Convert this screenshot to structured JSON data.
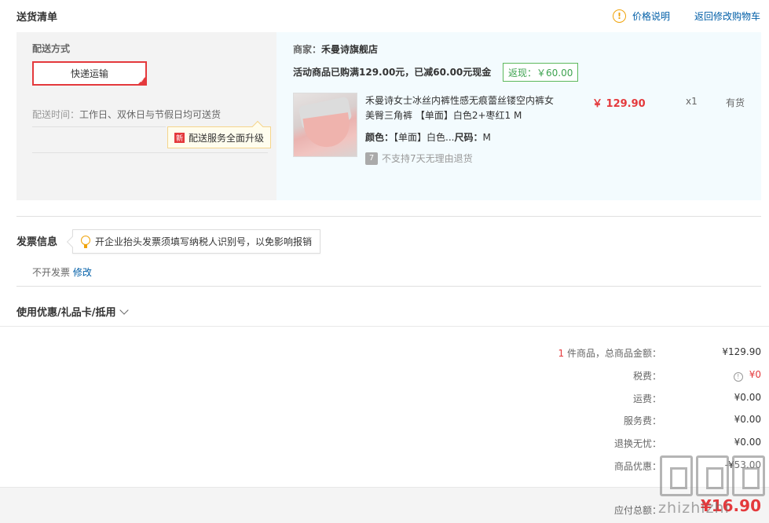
{
  "header": {
    "title": "送货清单",
    "price_info": "价格说明",
    "back_to_cart": "返回修改购物车"
  },
  "shipping": {
    "method_label": "配送方式",
    "method": "快递运输",
    "time_label": "配送时间：",
    "time_value": "工作日、双休日与节假日均可送货",
    "upgrade_badge": "新",
    "upgrade_text": "配送服务全面升级"
  },
  "order": {
    "merchant_label": "商家：",
    "merchant": "禾曼诗旗舰店",
    "promo": "活动商品已购满129.00元，已减60.00元现金",
    "cashback": "返现：￥60.00",
    "product": {
      "name": "禾曼诗女士冰丝内裤性感无痕蕾丝镂空内裤女美臀三角裤 【单面】白色2+枣红1 M",
      "price": "￥ 129.90",
      "qty": "x1",
      "stock": "有货",
      "color_label": "颜色：",
      "color": "【单面】白色...",
      "size_label": "尺码：",
      "size": "M",
      "return_icon": "7",
      "return_policy": "不支持7天无理由退货"
    }
  },
  "invoice": {
    "title": "发票信息",
    "tip": "开企业抬头发票须填写纳税人识别号，以免影响报销",
    "status": "不开发票",
    "modify": "修改"
  },
  "coupon": {
    "title": "使用优惠/礼品卡/抵用"
  },
  "summary": {
    "item_count": "1",
    "item_label": " 件商品，总商品金额：",
    "item_total": "¥129.90",
    "tax_label": "税费：",
    "tax_value": "¥0",
    "freight_label": "运费：",
    "freight_value": "¥0.00",
    "service_label": "服务费：",
    "service_value": "¥0.00",
    "return_label": "退换无忧：",
    "return_value": "¥0.00",
    "discount_label": "商品优惠：",
    "discount_value": "-¥53.00",
    "pay_label": "应付总额：",
    "pay_value": "¥16.90"
  },
  "watermark": "zhizhizhi"
}
